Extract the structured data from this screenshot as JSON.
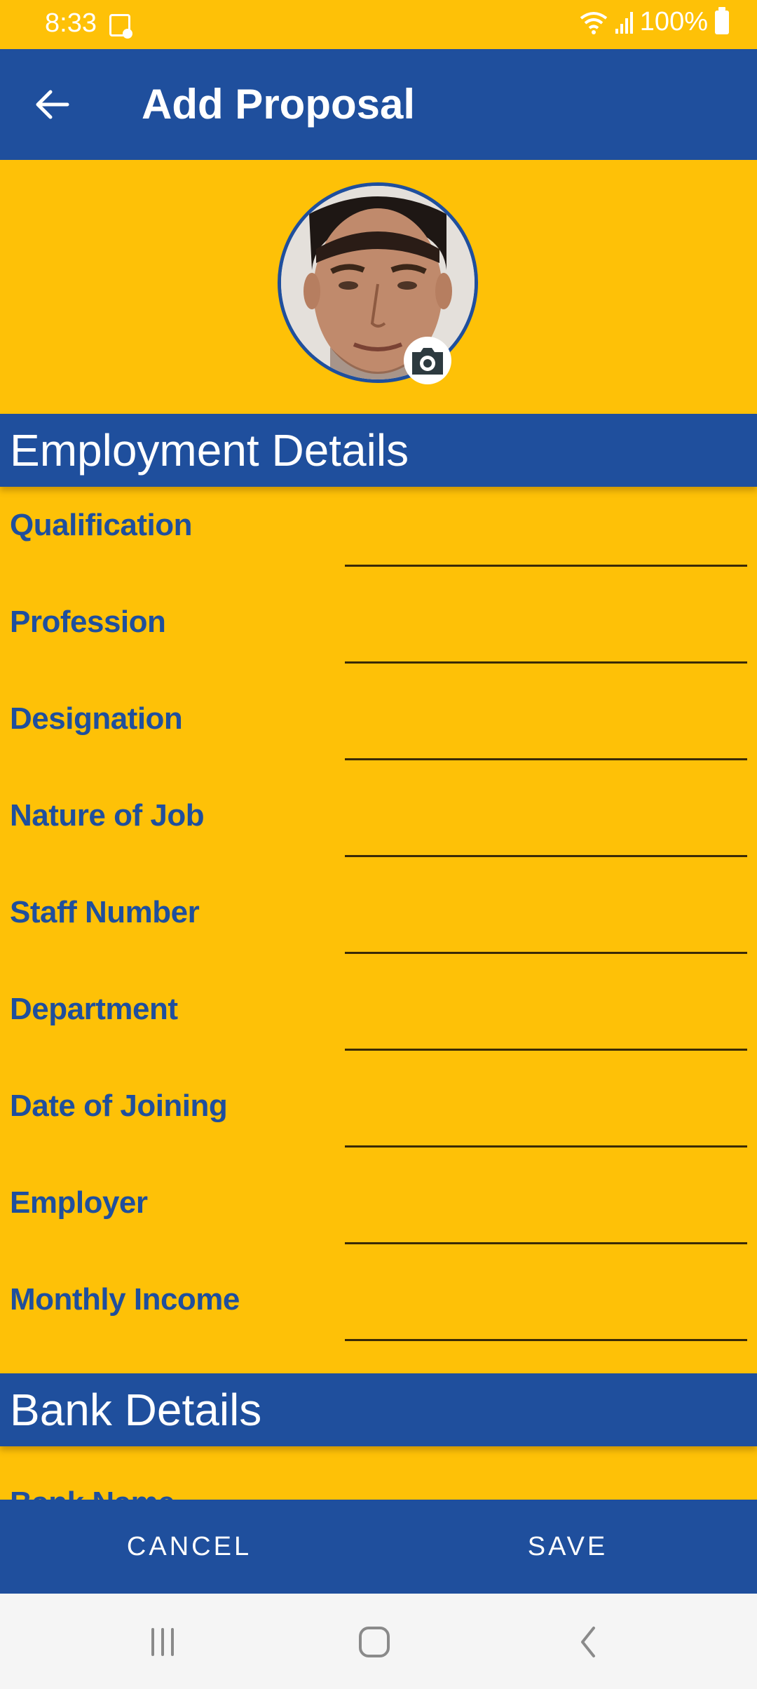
{
  "status_bar": {
    "time": "8:33",
    "battery": "100%",
    "icons": [
      "notification-icon",
      "wifi-icon",
      "signal-icon",
      "battery-icon"
    ]
  },
  "app_bar": {
    "title": "Add Proposal",
    "back_icon": "arrow-left-icon"
  },
  "profile": {
    "avatar_alt": "Applicant photo",
    "camera_icon": "camera-icon"
  },
  "sections": [
    {
      "title": "Employment Details",
      "fields": [
        {
          "label": "Qualification",
          "value": ""
        },
        {
          "label": "Profession",
          "value": ""
        },
        {
          "label": "Designation",
          "value": ""
        },
        {
          "label": "Nature of Job",
          "value": ""
        },
        {
          "label": "Staff Number",
          "value": ""
        },
        {
          "label": "Department",
          "value": ""
        },
        {
          "label": "Date of Joining",
          "value": ""
        },
        {
          "label": "Employer",
          "value": ""
        },
        {
          "label": "Monthly Income",
          "value": ""
        }
      ]
    },
    {
      "title": "Bank Details",
      "fields": [
        {
          "label": "Bank Name",
          "value": ""
        }
      ]
    }
  ],
  "actions": {
    "cancel": "CANCEL",
    "save": "SAVE"
  },
  "colors": {
    "background": "#FEC107",
    "primary": "#1F4F9D",
    "nav_bar": "#F5F5F5"
  }
}
